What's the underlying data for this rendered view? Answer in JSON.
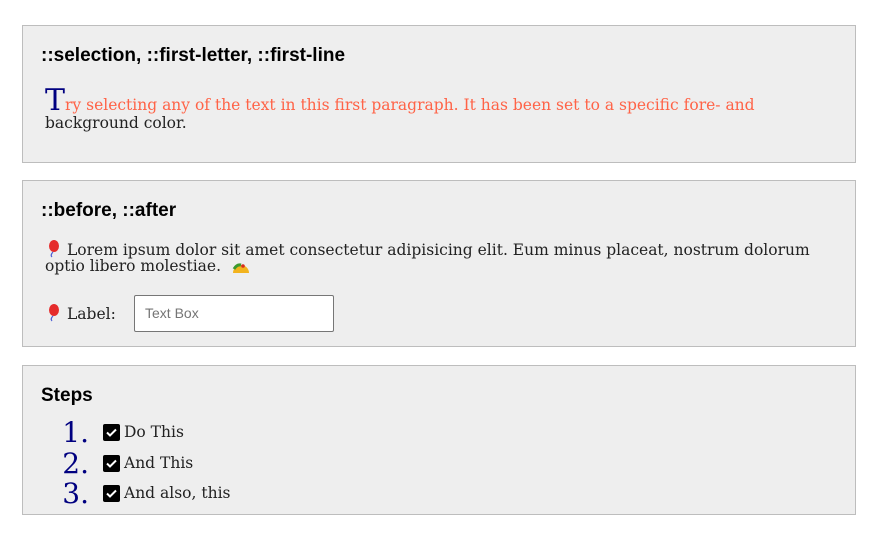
{
  "section1": {
    "title": "::selection, ::first-letter, ::first-line",
    "first_letter": "T",
    "first_line": "ry selecting any of the text in this first paragraph. It has been set to a specific fore- and",
    "rest": "background color."
  },
  "section2": {
    "title": "::before, ::after",
    "paragraph": "Lorem ipsum dolor sit amet consectetur adipisicing elit. Eum minus placeat, nostrum dolorum optio libero molestiae.",
    "label": "Label:",
    "input_placeholder": "Text Box"
  },
  "section3": {
    "title": "Steps",
    "steps": [
      {
        "num": "1.",
        "text": "Do This"
      },
      {
        "num": "2.",
        "text": "And This"
      },
      {
        "num": "3.",
        "text": "And also, this"
      }
    ]
  },
  "colors": {
    "first_line": "#ff6347",
    "first_letter": "#000080",
    "box_bg": "#eeeeee"
  }
}
